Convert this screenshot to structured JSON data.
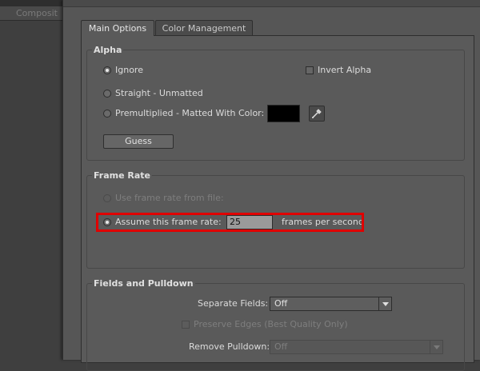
{
  "background": {
    "tab_label": "Composit"
  },
  "tabs": [
    {
      "label": "Main Options",
      "active": true
    },
    {
      "label": "Color Management",
      "active": false
    }
  ],
  "alpha": {
    "title": "Alpha",
    "ignore_label": "Ignore",
    "invert_label": "Invert Alpha",
    "straight_label": "Straight - Unmatted",
    "premultiplied_label": "Premultiplied - Matted With Color:",
    "matte_color": "#000000",
    "guess_label": "Guess",
    "selected": "Ignore"
  },
  "frame_rate": {
    "title": "Frame Rate",
    "use_file_label": "Use frame rate from file:",
    "assume_label": "Assume this frame rate:",
    "value": "25",
    "unit_label": "frames per second",
    "selected": "Assume this frame rate"
  },
  "fields": {
    "title": "Fields and Pulldown",
    "separate_fields_label": "Separate Fields:",
    "separate_fields_value": "Off",
    "preserve_edges_label": "Preserve Edges (Best Quality Only)",
    "remove_pulldown_label": "Remove Pulldown:",
    "remove_pulldown_value": "Off"
  },
  "highlight_color": "#e00000"
}
